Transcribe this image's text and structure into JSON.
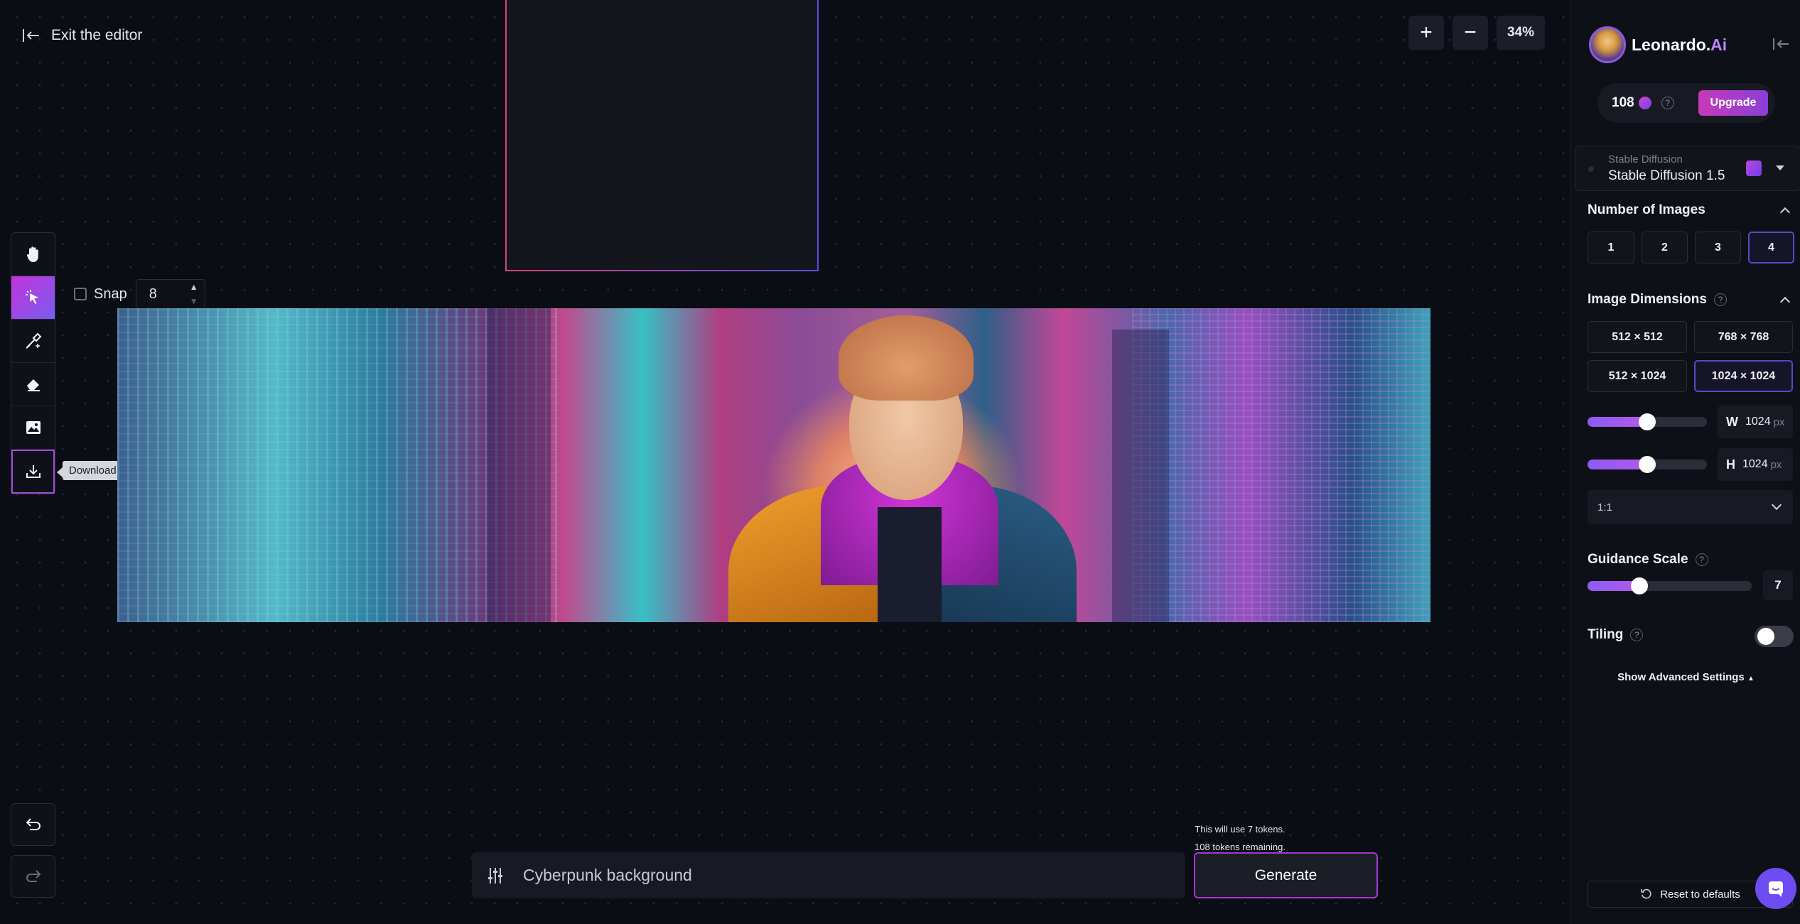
{
  "editor": {
    "exit_label": "Exit the editor",
    "zoom_in": "+",
    "zoom_out": "−",
    "zoom_level": "34%",
    "snap_label": "Snap",
    "snap_value": "8",
    "download_tooltip": "Download Artwork",
    "tools": [
      "hand-icon",
      "select-icon",
      "inpaint-brush-icon",
      "eraser-icon",
      "image-upload-icon",
      "download-icon"
    ],
    "tokens_line1": "This will use 7 tokens.",
    "tokens_line2": "108 tokens remaining.",
    "prompt_value": "Cyberpunk background",
    "generate_label": "Generate"
  },
  "panel": {
    "brand_name": "Leonardo.",
    "brand_accent": "Ai",
    "credits": "108",
    "upgrade_label": "Upgrade",
    "model_provider": "Stable Diffusion",
    "model_name": "Stable Diffusion 1.5",
    "num_images_title": "Number of Images",
    "num_images_options": [
      "1",
      "2",
      "3",
      "4"
    ],
    "num_images_selected": "4",
    "dimensions_title": "Image Dimensions",
    "dimension_options": [
      "512 × 512",
      "768 × 768",
      "512 × 1024",
      "1024 × 1024"
    ],
    "dimension_selected": "1024 × 1024",
    "width_label": "W",
    "width_value": "1024",
    "height_label": "H",
    "height_value": "1024",
    "unit": "px",
    "aspect_ratio": "1:1",
    "guidance_title": "Guidance Scale",
    "guidance_value": "7",
    "tiling_title": "Tiling",
    "tiling_on": false,
    "advanced_label": "Show Advanced Settings",
    "reset_label": "Reset to defaults",
    "help_glyph": "?"
  },
  "colors": {
    "accent_gradient_start": "#c234d9",
    "accent_gradient_end": "#7a5cf0",
    "selected_border": "#5b48c8",
    "generate_border": "#a337d0",
    "chat_button": "#6d4df2"
  }
}
